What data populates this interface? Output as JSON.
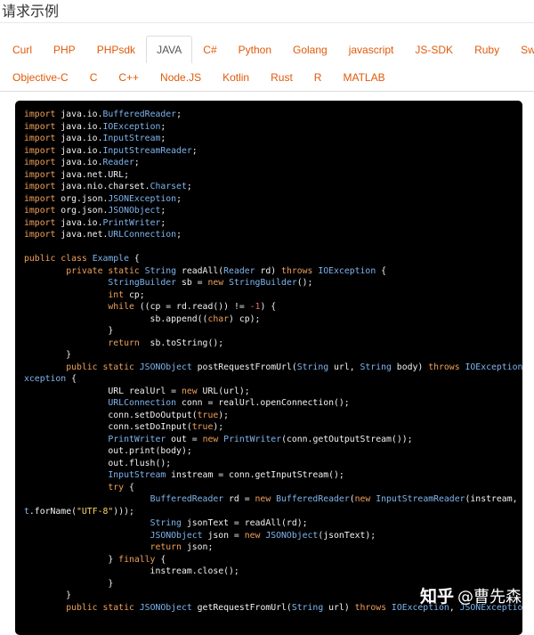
{
  "section_title": "请求示例",
  "tabs_row1": [
    "Curl",
    "PHP",
    "PHPsdk",
    "JAVA",
    "C#",
    "Python",
    "Golang",
    "javascript",
    "JS-SDK",
    "Ruby",
    "Swift"
  ],
  "tabs_row2": [
    "Objective-C",
    "C",
    "C++",
    "Node.JS",
    "Kotlin",
    "Rust",
    "R",
    "MATLAB"
  ],
  "active_tab": "JAVA",
  "colors": {
    "tab_text": "#e15a0a",
    "code_bg": "#000000",
    "keyword": "#f0a05a",
    "type": "#7fb4ef",
    "string": "#ffd866",
    "number": "#f16c6c"
  },
  "code_lines": [
    [
      [
        "kw",
        "import"
      ],
      [
        "p",
        " java.io."
      ],
      [
        "ty",
        "BufferedReader"
      ],
      [
        "p",
        ";"
      ]
    ],
    [
      [
        "kw",
        "import"
      ],
      [
        "p",
        " java.io."
      ],
      [
        "ty",
        "IOException"
      ],
      [
        "p",
        ";"
      ]
    ],
    [
      [
        "kw",
        "import"
      ],
      [
        "p",
        " java.io."
      ],
      [
        "ty",
        "InputStream"
      ],
      [
        "p",
        ";"
      ]
    ],
    [
      [
        "kw",
        "import"
      ],
      [
        "p",
        " java.io."
      ],
      [
        "ty",
        "InputStreamReader"
      ],
      [
        "p",
        ";"
      ]
    ],
    [
      [
        "kw",
        "import"
      ],
      [
        "p",
        " java.io."
      ],
      [
        "ty",
        "Reader"
      ],
      [
        "p",
        ";"
      ]
    ],
    [
      [
        "kw",
        "import"
      ],
      [
        "p",
        " java.net.URL;"
      ]
    ],
    [
      [
        "kw",
        "import"
      ],
      [
        "p",
        " java.nio.charset."
      ],
      [
        "ty",
        "Charset"
      ],
      [
        "p",
        ";"
      ]
    ],
    [
      [
        "kw",
        "import"
      ],
      [
        "p",
        " org.json."
      ],
      [
        "ty",
        "JSONException"
      ],
      [
        "p",
        ";"
      ]
    ],
    [
      [
        "kw",
        "import"
      ],
      [
        "p",
        " org.json."
      ],
      [
        "ty",
        "JSONObject"
      ],
      [
        "p",
        ";"
      ]
    ],
    [
      [
        "kw",
        "import"
      ],
      [
        "p",
        " java.io."
      ],
      [
        "ty",
        "PrintWriter"
      ],
      [
        "p",
        ";"
      ]
    ],
    [
      [
        "kw",
        "import"
      ],
      [
        "p",
        " java.net."
      ],
      [
        "ty",
        "URLConnection"
      ],
      [
        "p",
        ";"
      ]
    ],
    [],
    [
      [
        "kw",
        "public class"
      ],
      [
        "p",
        " "
      ],
      [
        "ty",
        "Example"
      ],
      [
        "p",
        " {"
      ]
    ],
    [
      [
        "p",
        "        "
      ],
      [
        "kw",
        "private static"
      ],
      [
        "p",
        " "
      ],
      [
        "ty",
        "String"
      ],
      [
        "p",
        " readAll("
      ],
      [
        "ty",
        "Reader"
      ],
      [
        "p",
        " rd) "
      ],
      [
        "kw",
        "throws"
      ],
      [
        "p",
        " "
      ],
      [
        "ty",
        "IOException"
      ],
      [
        "p",
        " {"
      ]
    ],
    [
      [
        "p",
        "                "
      ],
      [
        "ty",
        "StringBuilder"
      ],
      [
        "p",
        " sb = "
      ],
      [
        "kw",
        "new"
      ],
      [
        "p",
        " "
      ],
      [
        "ty",
        "StringBuilder"
      ],
      [
        "p",
        "();"
      ]
    ],
    [
      [
        "p",
        "                "
      ],
      [
        "kw",
        "int"
      ],
      [
        "p",
        " cp;"
      ]
    ],
    [
      [
        "p",
        "                "
      ],
      [
        "kw",
        "while"
      ],
      [
        "p",
        " ((cp = rd.read()) != "
      ],
      [
        "nu",
        "-1"
      ],
      [
        "p",
        ") {"
      ]
    ],
    [
      [
        "p",
        "                        sb.append(("
      ],
      [
        "kw",
        "char"
      ],
      [
        "p",
        ") cp);"
      ]
    ],
    [
      [
        "p",
        "                }"
      ]
    ],
    [
      [
        "p",
        "                "
      ],
      [
        "kw",
        "return"
      ],
      [
        "p",
        "  sb.toString();"
      ]
    ],
    [
      [
        "p",
        "        }"
      ]
    ],
    [
      [
        "p",
        "        "
      ],
      [
        "kw",
        "public static"
      ],
      [
        "p",
        " "
      ],
      [
        "ty",
        "JSONObject"
      ],
      [
        "p",
        " postRequestFromUrl("
      ],
      [
        "ty",
        "String"
      ],
      [
        "p",
        " url, "
      ],
      [
        "ty",
        "String"
      ],
      [
        "p",
        " body) "
      ],
      [
        "kw",
        "throws"
      ],
      [
        "p",
        " "
      ],
      [
        "ty",
        "IOException"
      ],
      [
        "p",
        ", "
      ],
      [
        "ty",
        "JSONE"
      ]
    ],
    [
      [
        "ty",
        "xception"
      ],
      [
        "p",
        " {"
      ]
    ],
    [
      [
        "p",
        "                URL realUrl = "
      ],
      [
        "kw",
        "new"
      ],
      [
        "p",
        " URL(url);"
      ]
    ],
    [
      [
        "p",
        "                "
      ],
      [
        "ty",
        "URLConnection"
      ],
      [
        "p",
        " conn = realUrl.openConnection();"
      ]
    ],
    [
      [
        "p",
        "                conn.setDoOutput("
      ],
      [
        "kw",
        "true"
      ],
      [
        "p",
        ");"
      ]
    ],
    [
      [
        "p",
        "                conn.setDoInput("
      ],
      [
        "kw",
        "true"
      ],
      [
        "p",
        ");"
      ]
    ],
    [
      [
        "p",
        "                "
      ],
      [
        "ty",
        "PrintWriter"
      ],
      [
        "p",
        " out = "
      ],
      [
        "kw",
        "new"
      ],
      [
        "p",
        " "
      ],
      [
        "ty",
        "PrintWriter"
      ],
      [
        "p",
        "(conn.getOutputStream());"
      ]
    ],
    [
      [
        "p",
        "                out.print(body);"
      ]
    ],
    [
      [
        "p",
        "                out.flush();"
      ]
    ],
    [
      [
        "p",
        "                "
      ],
      [
        "ty",
        "InputStream"
      ],
      [
        "p",
        " instream = conn.getInputStream();"
      ]
    ],
    [
      [
        "p",
        "                "
      ],
      [
        "kw",
        "try"
      ],
      [
        "p",
        " {"
      ]
    ],
    [
      [
        "p",
        "                        "
      ],
      [
        "ty",
        "BufferedReader"
      ],
      [
        "p",
        " rd = "
      ],
      [
        "kw",
        "new"
      ],
      [
        "p",
        " "
      ],
      [
        "ty",
        "BufferedReader"
      ],
      [
        "p",
        "("
      ],
      [
        "kw",
        "new"
      ],
      [
        "p",
        " "
      ],
      [
        "ty",
        "InputStreamReader"
      ],
      [
        "p",
        "(instream, "
      ],
      [
        "ty",
        "Charse"
      ]
    ],
    [
      [
        "ty",
        "t"
      ],
      [
        "p",
        ".forName("
      ],
      [
        "st",
        "\"UTF-8\""
      ],
      [
        "p",
        ")));"
      ]
    ],
    [
      [
        "p",
        "                        "
      ],
      [
        "ty",
        "String"
      ],
      [
        "p",
        " jsonText = readAll(rd);"
      ]
    ],
    [
      [
        "p",
        "                        "
      ],
      [
        "ty",
        "JSONObject"
      ],
      [
        "p",
        " json = "
      ],
      [
        "kw",
        "new"
      ],
      [
        "p",
        " "
      ],
      [
        "ty",
        "JSONObject"
      ],
      [
        "p",
        "(jsonText);"
      ]
    ],
    [
      [
        "p",
        "                        "
      ],
      [
        "kw",
        "return"
      ],
      [
        "p",
        " json;"
      ]
    ],
    [
      [
        "p",
        "                } "
      ],
      [
        "kw",
        "finally"
      ],
      [
        "p",
        " {"
      ]
    ],
    [
      [
        "p",
        "                        instream.close();"
      ]
    ],
    [
      [
        "p",
        "                }"
      ]
    ],
    [
      [
        "p",
        "        }"
      ]
    ],
    [
      [
        "p",
        "        "
      ],
      [
        "kw",
        "public static"
      ],
      [
        "p",
        " "
      ],
      [
        "ty",
        "JSONObject"
      ],
      [
        "p",
        " getRequestFromUrl("
      ],
      [
        "ty",
        "String"
      ],
      [
        "p",
        " url) "
      ],
      [
        "kw",
        "throws"
      ],
      [
        "p",
        " "
      ],
      [
        "ty",
        "IOException"
      ],
      [
        "p",
        ", "
      ],
      [
        "ty",
        "JSONException"
      ],
      [
        "p",
        " {"
      ]
    ]
  ],
  "watermark": {
    "site": "知乎",
    "author": "@曹先森"
  }
}
